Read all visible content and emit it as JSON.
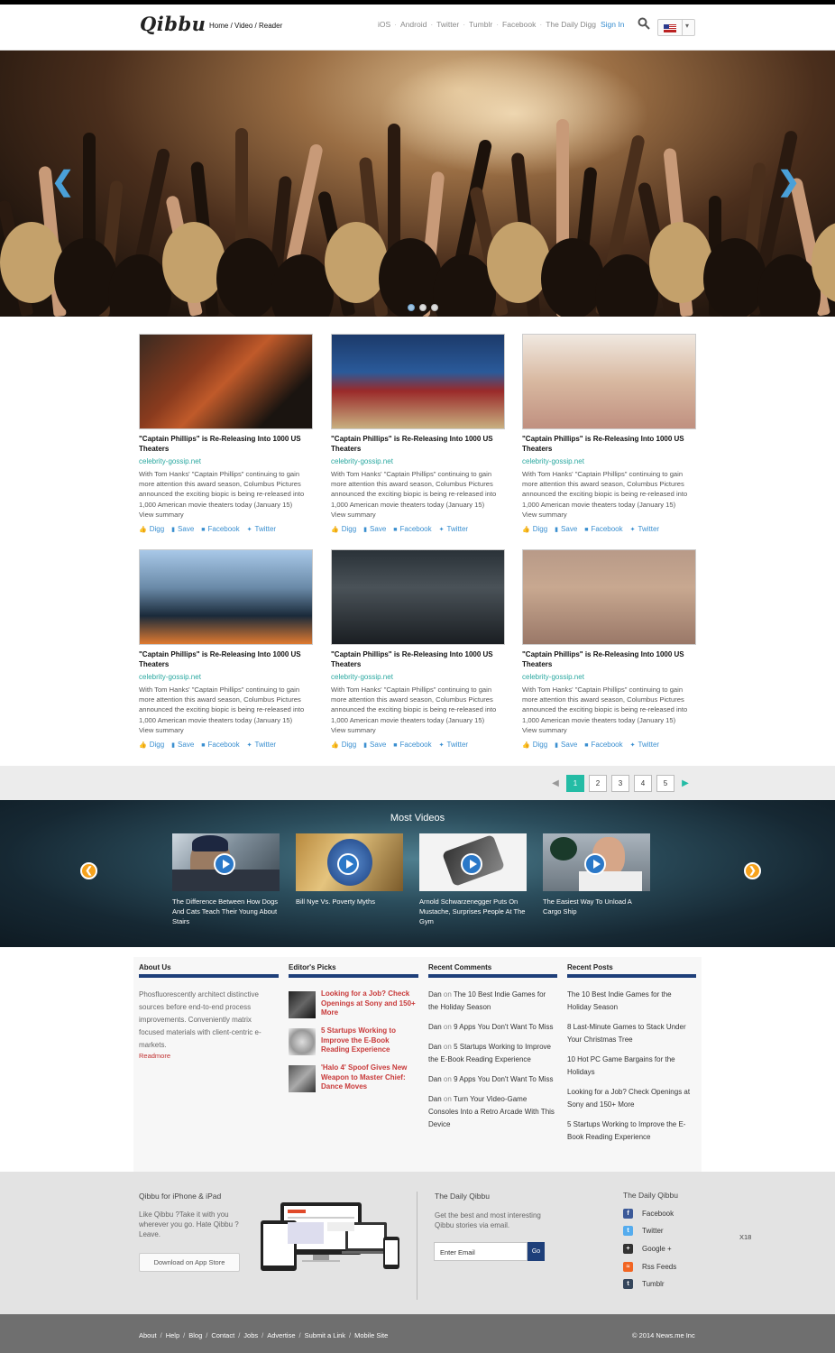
{
  "header": {
    "logo": "Qibbu",
    "breadcrumb": "Home / Video / Reader",
    "nav": [
      "iOS",
      "Android",
      "Twitter",
      "Tumblr",
      "Facebook",
      "The Daily Digg"
    ],
    "sign_in": "Sign In"
  },
  "slider": {
    "prev_icon": "chevron-left-icon",
    "next_icon": "chevron-right-icon",
    "slides": 3,
    "active_slide": 1
  },
  "articles": [
    {
      "title": "\"Captain Phillips\" is Re-Releasing Into 1000 US Theaters",
      "source": "celebrity-gossip.net",
      "summary": "With Tom Hanks' \"Captain Phillips\" continuing to gain more attention this award season, Columbus Pictures announced the exciting biopic is being re-released into 1,000 American movie theaters today (January 15)",
      "view": "View summary"
    },
    {
      "title": "\"Captain Phillips\" is Re-Releasing Into 1000 US Theaters",
      "source": "celebrity-gossip.net",
      "summary": "With Tom Hanks' \"Captain Phillips\" continuing to gain more attention this award season, Columbus Pictures announced the exciting biopic is being re-released into 1,000 American movie theaters today (January 15)",
      "view": "View summary"
    },
    {
      "title": "\"Captain Phillips\" is Re-Releasing Into 1000 US Theaters",
      "source": "celebrity-gossip.net",
      "summary": "With Tom Hanks' \"Captain Phillips\" continuing to gain more attention this award season, Columbus Pictures announced the exciting biopic is being re-released into 1,000 American movie theaters today (January 15)",
      "view": "View summary"
    },
    {
      "title": "\"Captain Phillips\" is Re-Releasing Into 1000 US Theaters",
      "source": "celebrity-gossip.net",
      "summary": "With Tom Hanks' \"Captain Phillips\" continuing to gain more attention this award season, Columbus Pictures announced the exciting biopic is being re-released into 1,000 American movie theaters today (January 15)",
      "view": "View summary"
    },
    {
      "title": "\"Captain Phillips\" is Re-Releasing Into 1000 US Theaters",
      "source": "celebrity-gossip.net",
      "summary": "With Tom Hanks' \"Captain Phillips\" continuing to gain more attention this award season, Columbus Pictures announced the exciting biopic is being re-released into 1,000 American movie theaters today (January 15)",
      "view": "View summary"
    },
    {
      "title": "\"Captain Phillips\" is Re-Releasing Into 1000 US Theaters",
      "source": "celebrity-gossip.net",
      "summary": "With Tom Hanks' \"Captain Phillips\" continuing to gain more attention this award season, Columbus Pictures announced the exciting biopic is being re-released into 1,000 American movie theaters today (January 15)",
      "view": "View summary"
    }
  ],
  "actions": {
    "digg": "Digg",
    "save": "Save",
    "facebook": "Facebook",
    "twitter": "Twitter"
  },
  "pagination": {
    "pages": [
      "1",
      "2",
      "3",
      "4",
      "5"
    ],
    "current": "1"
  },
  "videos": {
    "title": "Most Videos",
    "items": [
      "The Difference Between How Dogs And Cats Teach Their Young About Stairs",
      "Bill Nye Vs. Poverty Myths",
      "Arnold Schwarzenegger Puts On Mustache, Surprises People At The Gym",
      "The Easiest Way To Unload A Cargo Ship"
    ]
  },
  "about": {
    "heading": "About Us",
    "text": "Phosfluorescently architect distinctive sources before end-to-end process improvements. Conveniently matrix focused materials with client-centric e-markets.",
    "readmore": "Readmore"
  },
  "picks": {
    "heading": "Editor's Picks",
    "items": [
      "Looking for a Job? Check Openings at Sony and 150+ More",
      "5 Startups Working to Improve the E-Book Reading Experience",
      "'Halo 4' Spoof Gives New Weapon to Master Chief: Dance Moves"
    ]
  },
  "comments": {
    "heading": "Recent Comments",
    "on": "on",
    "items": [
      {
        "by": "Dan",
        "post": "The 10 Best Indie Games for the Holiday Season"
      },
      {
        "by": "Dan",
        "post": "9 Apps You Don't Want To Miss"
      },
      {
        "by": "Dan",
        "post": "5 Startups Working to Improve the E-Book Reading Experience"
      },
      {
        "by": "Dan",
        "post": "9 Apps You Don't Want To Miss"
      },
      {
        "by": "Dan",
        "post": "Turn Your Video-Game Consoles Into a Retro Arcade With This Device"
      }
    ]
  },
  "posts": {
    "heading": "Recent Posts",
    "items": [
      "The 10 Best Indie Games for the Holiday Season",
      "8 Last-Minute Games to Stack Under Your Christmas Tree",
      "10 Hot PC Game Bargains for the Holidays",
      "Looking for a Job? Check Openings at Sony and 150+ More",
      "5 Startups Working to Improve the E-Book Reading Experience"
    ]
  },
  "footer": {
    "app_title": "Qibbu for iPhone & iPad",
    "app_text": "Like Qibbu ?Take it with you wherever you go. Hate Qibbu ? Leave.",
    "app_button": "Download on App Store",
    "daily_title": "The Daily Qibbu",
    "daily_text": "Get the best and most interesting Qibbu stories via email.",
    "email_placeholder": "Enter Email",
    "go": "Go",
    "social_title": "The Daily Qibbu",
    "social": [
      "Facebook",
      "Twitter",
      "Google +",
      "Rss Feeds",
      "Tumblr"
    ],
    "badge": "X18"
  },
  "bottom": {
    "links": [
      "About",
      "Help",
      "Blog",
      "Contact",
      "Jobs",
      "Advertise",
      "Submit a Link",
      "Mobile Site"
    ],
    "copyright": "© 2014 News.me Inc"
  },
  "colors": {
    "accent": "#24bca5",
    "link": "#3a8fd0",
    "navy": "#1e3f7a",
    "pick": "#c83a3a",
    "video_nav": "#f6a21c"
  }
}
